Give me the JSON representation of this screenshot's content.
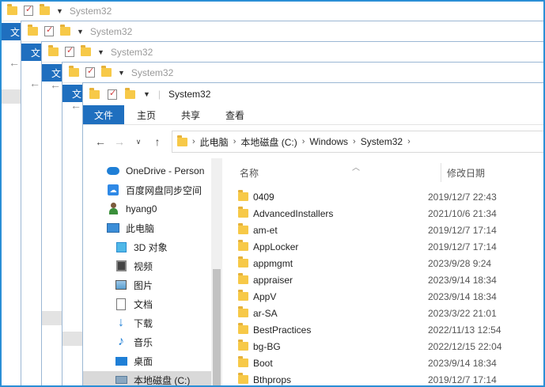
{
  "window_title": "System32",
  "background_windows": [
    {
      "title": "System32",
      "ribbon_tab": "文"
    },
    {
      "title": "System32",
      "ribbon_tab": "文"
    },
    {
      "title": "System32",
      "ribbon_tab": "文"
    },
    {
      "title": "System32",
      "ribbon_tab": "文"
    }
  ],
  "ribbon": {
    "tabs": [
      "文件",
      "主页",
      "共享",
      "查看"
    ]
  },
  "address": {
    "crumbs": [
      "此电脑",
      "本地磁盘 (C:)",
      "Windows",
      "System32"
    ]
  },
  "nav": {
    "items": [
      {
        "label": "OneDrive - Person",
        "icon": "onedrive-icon"
      },
      {
        "label": "百度网盘同步空间",
        "icon": "baidu-netdisk-icon"
      },
      {
        "label": "hyang0",
        "icon": "user-icon"
      },
      {
        "label": "此电脑",
        "icon": "this-pc-icon"
      },
      {
        "label": "3D 对象",
        "icon": "3d-objects-icon"
      },
      {
        "label": "视频",
        "icon": "videos-icon"
      },
      {
        "label": "图片",
        "icon": "pictures-icon"
      },
      {
        "label": "文档",
        "icon": "documents-icon"
      },
      {
        "label": "下载",
        "icon": "downloads-icon"
      },
      {
        "label": "音乐",
        "icon": "music-icon"
      },
      {
        "label": "桌面",
        "icon": "desktop-icon"
      },
      {
        "label": "本地磁盘 (C:)",
        "icon": "drive-icon"
      }
    ]
  },
  "columns": {
    "name": "名称",
    "date": "修改日期"
  },
  "files": [
    {
      "name": "0409",
      "date": "2019/12/7 22:43"
    },
    {
      "name": "AdvancedInstallers",
      "date": "2021/10/6 21:34"
    },
    {
      "name": "am-et",
      "date": "2019/12/7 17:14"
    },
    {
      "name": "AppLocker",
      "date": "2019/12/7 17:14"
    },
    {
      "name": "appmgmt",
      "date": "2023/9/28 9:24"
    },
    {
      "name": "appraiser",
      "date": "2023/9/14 18:34"
    },
    {
      "name": "AppV",
      "date": "2023/9/14 18:34"
    },
    {
      "name": "ar-SA",
      "date": "2023/3/22 21:01"
    },
    {
      "name": "BestPractices",
      "date": "2022/11/13 12:54"
    },
    {
      "name": "bg-BG",
      "date": "2022/12/15 22:04"
    },
    {
      "name": "Boot",
      "date": "2023/9/14 18:34"
    },
    {
      "name": "Bthprops",
      "date": "2019/12/7 17:14"
    }
  ]
}
